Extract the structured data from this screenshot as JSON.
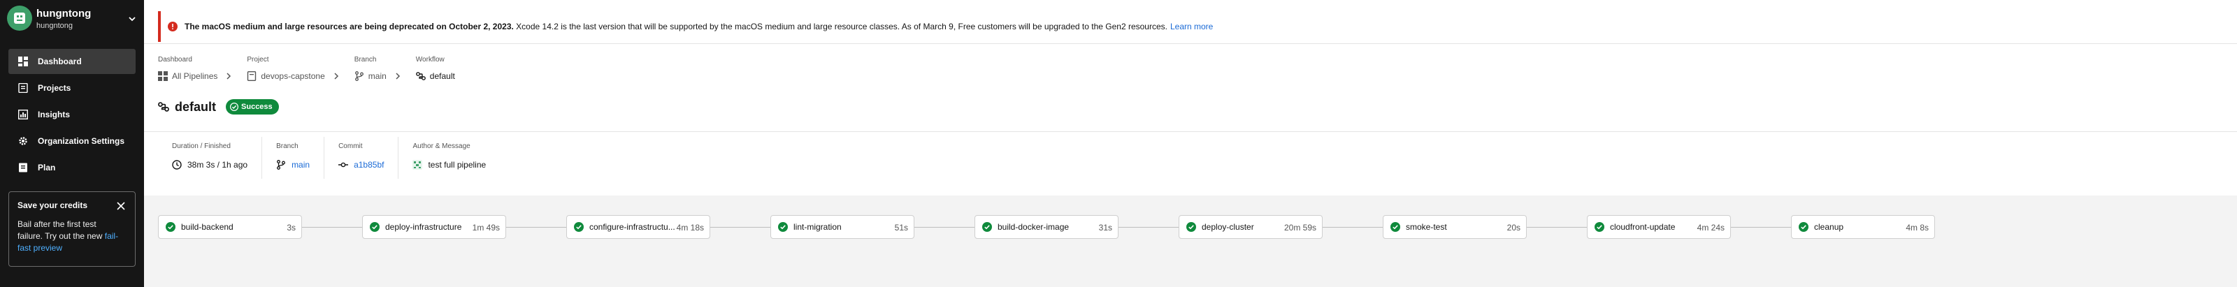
{
  "sidebar": {
    "org": {
      "name": "hungntong",
      "sub": "hungntong"
    },
    "nav": [
      {
        "label": "Dashboard",
        "icon": "dashboard-icon",
        "active": true
      },
      {
        "label": "Projects",
        "icon": "projects-icon",
        "active": false
      },
      {
        "label": "Insights",
        "icon": "insights-icon",
        "active": false
      },
      {
        "label": "Organization Settings",
        "icon": "settings-gear-icon",
        "active": false
      },
      {
        "label": "Plan",
        "icon": "plan-icon",
        "active": false
      }
    ],
    "credits": {
      "title": "Save your credits",
      "body": "Bail after the first test failure. Try out the new",
      "link": "fail-fast preview"
    }
  },
  "banner": {
    "bold": "The macOS medium and large resources are being deprecated on October 2, 2023.",
    "text": " Xcode 14.2 is the last version that will be supported by the macOS medium and large resource classes. As of March 9, Free customers will be upgraded to the Gen2 resources.",
    "link": "Learn more",
    "color": "#d42b1f"
  },
  "breadcrumbs": [
    {
      "head": "Dashboard",
      "value": "All Pipelines",
      "icon": "pipelines-icon"
    },
    {
      "head": "Project",
      "value": "devops-capstone",
      "icon": "project-icon"
    },
    {
      "head": "Branch",
      "value": "main",
      "icon": "branch-icon"
    },
    {
      "head": "Workflow",
      "value": "default",
      "icon": "workflow-icon"
    }
  ],
  "workflow": {
    "title": "default",
    "status": "Success",
    "status_color": "#0f8a3c"
  },
  "meta": {
    "duration_head": "Duration / Finished",
    "duration": "38m 3s / 1h ago",
    "branch_head": "Branch",
    "branch": "main",
    "commit_head": "Commit",
    "commit": "a1b85bf",
    "author_head": "Author & Message",
    "message": "test full pipeline"
  },
  "jobs": [
    {
      "name": "build-backend",
      "duration": "3s"
    },
    {
      "name": "deploy-infrastructure",
      "duration": "1m 49s"
    },
    {
      "name": "configure-infrastructu...",
      "duration": "4m 18s"
    },
    {
      "name": "lint-migration",
      "duration": "51s"
    },
    {
      "name": "build-docker-image",
      "duration": "31s"
    },
    {
      "name": "deploy-cluster",
      "duration": "20m 59s"
    },
    {
      "name": "smoke-test",
      "duration": "20s"
    },
    {
      "name": "cloudfront-update",
      "duration": "4m 24s"
    },
    {
      "name": "cleanup",
      "duration": "4m 8s"
    }
  ],
  "colors": {
    "success": "#0f8a3c",
    "link": "#1a6ad6",
    "sidebar_bg": "#161616"
  }
}
